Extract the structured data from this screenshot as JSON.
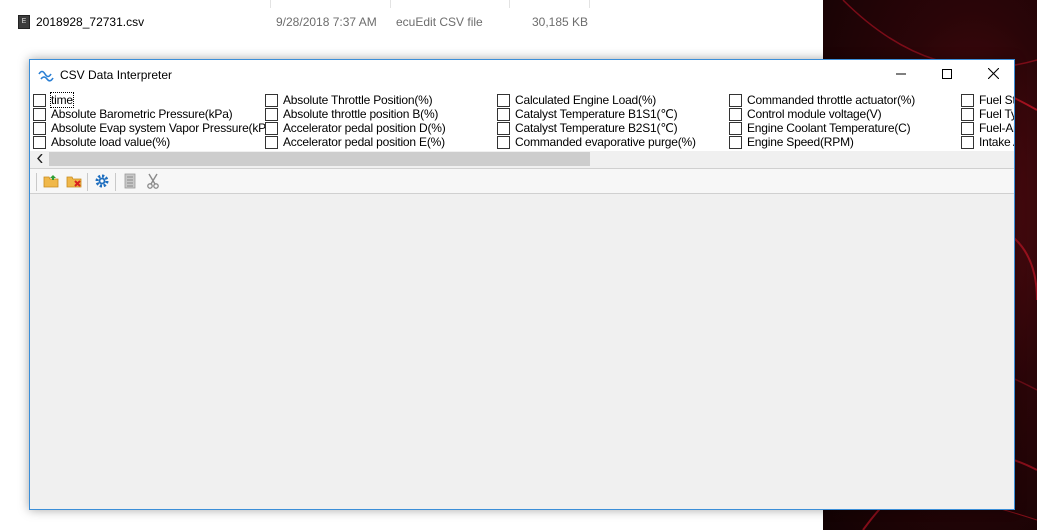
{
  "explorer_row": {
    "file_name": "2018928_72731.csv",
    "file_icon_glyph": "E",
    "date_modified": "9/28/2018 7:37 AM",
    "file_type": "ecuEdit CSV file",
    "file_size": "30,185 KB"
  },
  "window": {
    "title": "CSV Data Interpreter",
    "app_icon": "wave-icon",
    "controls": [
      "minimize-icon",
      "maximize-icon",
      "close-icon"
    ]
  },
  "checkbox_columns": [
    {
      "items": [
        {
          "label": "time",
          "checked": false,
          "focused": true
        },
        {
          "label": "Absolute Barometric Pressure(kPa)",
          "checked": false
        },
        {
          "label": "Absolute Evap system Vapor Pressure(kPa)",
          "checked": false
        },
        {
          "label": "Absolute load value(%)",
          "checked": false
        }
      ]
    },
    {
      "items": [
        {
          "label": "Absolute Throttle Position(%)",
          "checked": false
        },
        {
          "label": "Absolute throttle position B(%)",
          "checked": false
        },
        {
          "label": "Accelerator pedal position D(%)",
          "checked": false
        },
        {
          "label": "Accelerator pedal position E(%)",
          "checked": false
        }
      ]
    },
    {
      "items": [
        {
          "label": "Calculated Engine Load(%)",
          "checked": false
        },
        {
          "label": "Catalyst Temperature B1S1(℃)",
          "checked": false
        },
        {
          "label": "Catalyst Temperature B2S1(℃)",
          "checked": false
        },
        {
          "label": "Commanded evaporative purge(%)",
          "checked": false
        }
      ]
    },
    {
      "items": [
        {
          "label": "Commanded throttle actuator(%)",
          "checked": false
        },
        {
          "label": "Control module voltage(V)",
          "checked": false
        },
        {
          "label": "Engine Coolant Temperature(C)",
          "checked": false
        },
        {
          "label": "Engine Speed(RPM)",
          "checked": false
        }
      ]
    },
    {
      "items": [
        {
          "label": "Fuel Sta",
          "checked": false
        },
        {
          "label": "Fuel Ty",
          "checked": false
        },
        {
          "label": "Fuel-Ai",
          "checked": false
        },
        {
          "label": "Intake A",
          "checked": false
        }
      ]
    }
  ],
  "scrollbar": {
    "left_arrow": "chevron-left-icon"
  },
  "toolbar": {
    "buttons": [
      {
        "name": "open-folder-icon",
        "enabled": true
      },
      {
        "name": "close-folder-icon",
        "enabled": true
      },
      {
        "name": "settings-gear-icon",
        "enabled": true
      },
      {
        "name": "filter-icon",
        "enabled": false
      },
      {
        "name": "cut-icon",
        "enabled": false
      }
    ]
  },
  "colors": {
    "window_border": "#3b8ed8",
    "window_bg": "#f0f0f0",
    "folder_yellow": "#f0b84a",
    "delete_red": "#d92020",
    "gear_blue": "#1f6fbf",
    "wallpaper_red": "#c01525"
  }
}
